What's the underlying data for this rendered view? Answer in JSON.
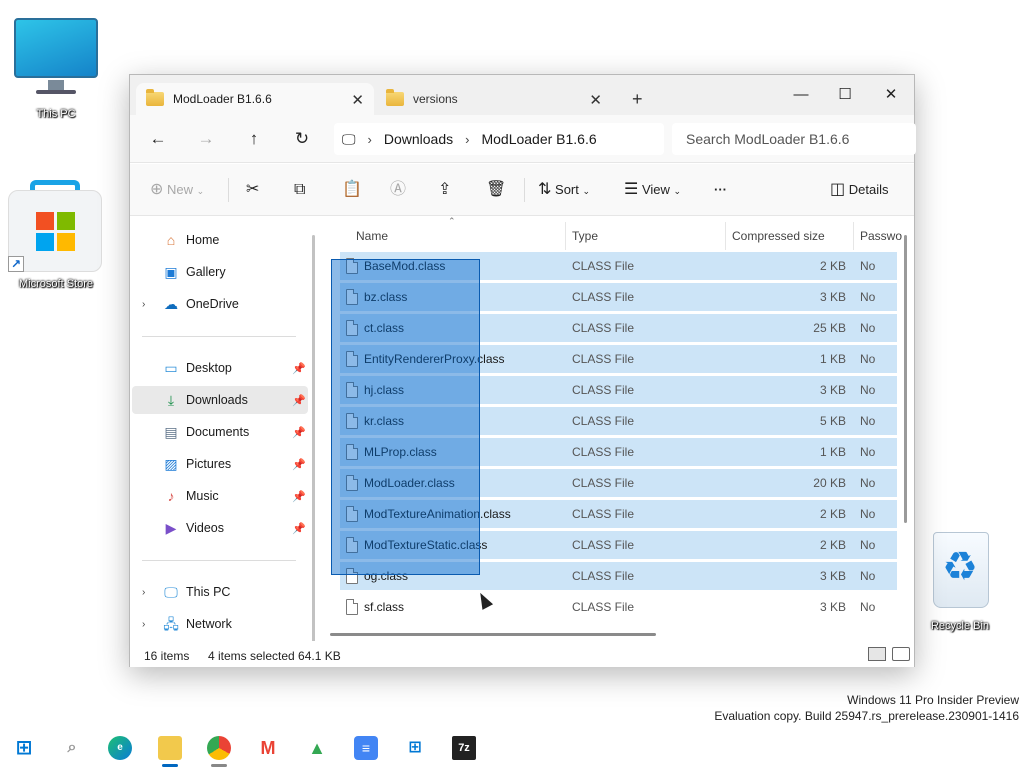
{
  "desktop": {
    "icons": [
      {
        "label": "This PC"
      },
      {
        "label": "Microsoft Store"
      },
      {
        "label": "Recycle Bin"
      }
    ]
  },
  "window": {
    "tabs": [
      {
        "label": "ModLoader B1.6.6",
        "active": true
      },
      {
        "label": "versions",
        "active": false
      }
    ],
    "controls": {
      "minimize": "—",
      "maximize": "☐",
      "close": "✕"
    }
  },
  "address": {
    "breadcrumb": [
      "Downloads",
      "ModLoader B1.6.6"
    ],
    "search_placeholder": "Search ModLoader B1.6.6"
  },
  "toolbar": {
    "new_label": "New",
    "sort_label": "Sort",
    "view_label": "View",
    "more_label": "···",
    "details_label": "Details"
  },
  "navpane": {
    "items": [
      {
        "label": "Home",
        "icon": "home-icon"
      },
      {
        "label": "Gallery",
        "icon": "gallery-icon"
      },
      {
        "label": "OneDrive",
        "icon": "cloud-icon"
      },
      {
        "label": "Desktop",
        "icon": "desktop-icon",
        "pinned": true
      },
      {
        "label": "Downloads",
        "icon": "download-icon",
        "pinned": true,
        "selected": true
      },
      {
        "label": "Documents",
        "icon": "document-icon",
        "pinned": true
      },
      {
        "label": "Pictures",
        "icon": "pictures-icon",
        "pinned": true
      },
      {
        "label": "Music",
        "icon": "music-icon",
        "pinned": true
      },
      {
        "label": "Videos",
        "icon": "videos-icon",
        "pinned": true
      },
      {
        "label": "This PC",
        "icon": "pc-icon"
      },
      {
        "label": "Network",
        "icon": "network-icon"
      }
    ]
  },
  "columns": [
    "Name",
    "Type",
    "Compressed size",
    "Passwo"
  ],
  "files": [
    {
      "name": "BaseMod.class",
      "type": "CLASS File",
      "size": "2 KB",
      "pw": "No",
      "selected": true
    },
    {
      "name": "bz.class",
      "type": "CLASS File",
      "size": "3 KB",
      "pw": "No",
      "selected": true
    },
    {
      "name": "ct.class",
      "type": "CLASS File",
      "size": "25 KB",
      "pw": "No",
      "selected": true
    },
    {
      "name": "EntityRendererProxy.class",
      "type": "CLASS File",
      "size": "1 KB",
      "pw": "No",
      "selected": true
    },
    {
      "name": "hj.class",
      "type": "CLASS File",
      "size": "3 KB",
      "pw": "No",
      "selected": true
    },
    {
      "name": "kr.class",
      "type": "CLASS File",
      "size": "5 KB",
      "pw": "No",
      "selected": true
    },
    {
      "name": "MLProp.class",
      "type": "CLASS File",
      "size": "1 KB",
      "pw": "No",
      "selected": true
    },
    {
      "name": "ModLoader.class",
      "type": "CLASS File",
      "size": "20 KB",
      "pw": "No",
      "selected": true
    },
    {
      "name": "ModTextureAnimation.class",
      "type": "CLASS File",
      "size": "2 KB",
      "pw": "No",
      "selected": true
    },
    {
      "name": "ModTextureStatic.class",
      "type": "CLASS File",
      "size": "2 KB",
      "pw": "No",
      "selected": true
    },
    {
      "name": "og.class",
      "type": "CLASS File",
      "size": "3 KB",
      "pw": "No",
      "selected": true
    },
    {
      "name": "sf.class",
      "type": "CLASS File",
      "size": "3 KB",
      "pw": "No",
      "selected": false
    }
  ],
  "status": {
    "items_count": "16 items",
    "selection": "4 items selected  64.1 KB"
  },
  "watermark": {
    "line1": "Windows 11 Pro Insider Preview",
    "line2": "Evaluation copy. Build 25947.rs_prerelease.230901-1416"
  },
  "taskbar": {
    "apps": [
      "start-icon",
      "search-icon",
      "edge-icon",
      "file-explorer-icon",
      "chrome-icon",
      "gmail-icon",
      "drive-icon",
      "docs-icon",
      "store-icon",
      "7zip-icon"
    ],
    "sevenzip_label": "7z"
  }
}
